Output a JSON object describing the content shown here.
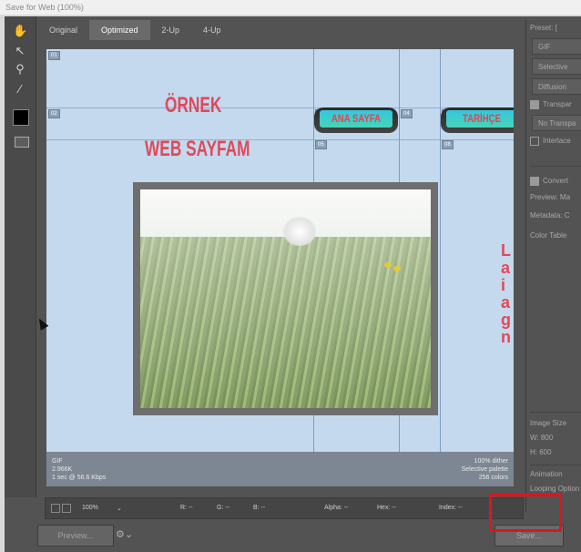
{
  "window": {
    "title": "Save for Web (100%)"
  },
  "tabs": [
    "Original",
    "Optimized",
    "2-Up",
    "4-Up"
  ],
  "canvas": {
    "heading_line1": "ÖRNEK",
    "heading_line2": "WEB SAYFAM",
    "nav_buttons": [
      "ANA SAYFA",
      "TARİHÇE"
    ],
    "slice_labels": [
      "01",
      "02",
      "03",
      "04",
      "05",
      "06",
      "08"
    ],
    "side_text": [
      "L",
      "a",
      "i",
      "a",
      "g",
      "n"
    ],
    "footer_left": [
      "GIF",
      "2.966K",
      "1 sec @ 56.6 Kbps"
    ],
    "footer_right": [
      "100% dither",
      "Selective palette",
      "256 colors"
    ]
  },
  "statusbar": {
    "zoom": "100%",
    "r": "R: --",
    "g": "G: --",
    "b": "B: --",
    "alpha": "Alpha: --",
    "hex": "Hex: --",
    "index": "Index: --"
  },
  "bottom": {
    "preview": "Preview...",
    "save": "Save..."
  },
  "panel": {
    "preset_label": "Preset: [",
    "format": "GIF",
    "reduction": "Selective",
    "dither": "Diffusion",
    "transparency": "Transpar",
    "matte": "No Transpa",
    "interlaced": "Interlace",
    "convert": "Convert",
    "preview": "Preview: Ma",
    "metadata": "Metadata: C",
    "color_table": "Color Table",
    "image_size": "Image Size",
    "w": "W: 800",
    "h": "H: 600",
    "animation": "Animation",
    "looping": "Looping Option"
  }
}
